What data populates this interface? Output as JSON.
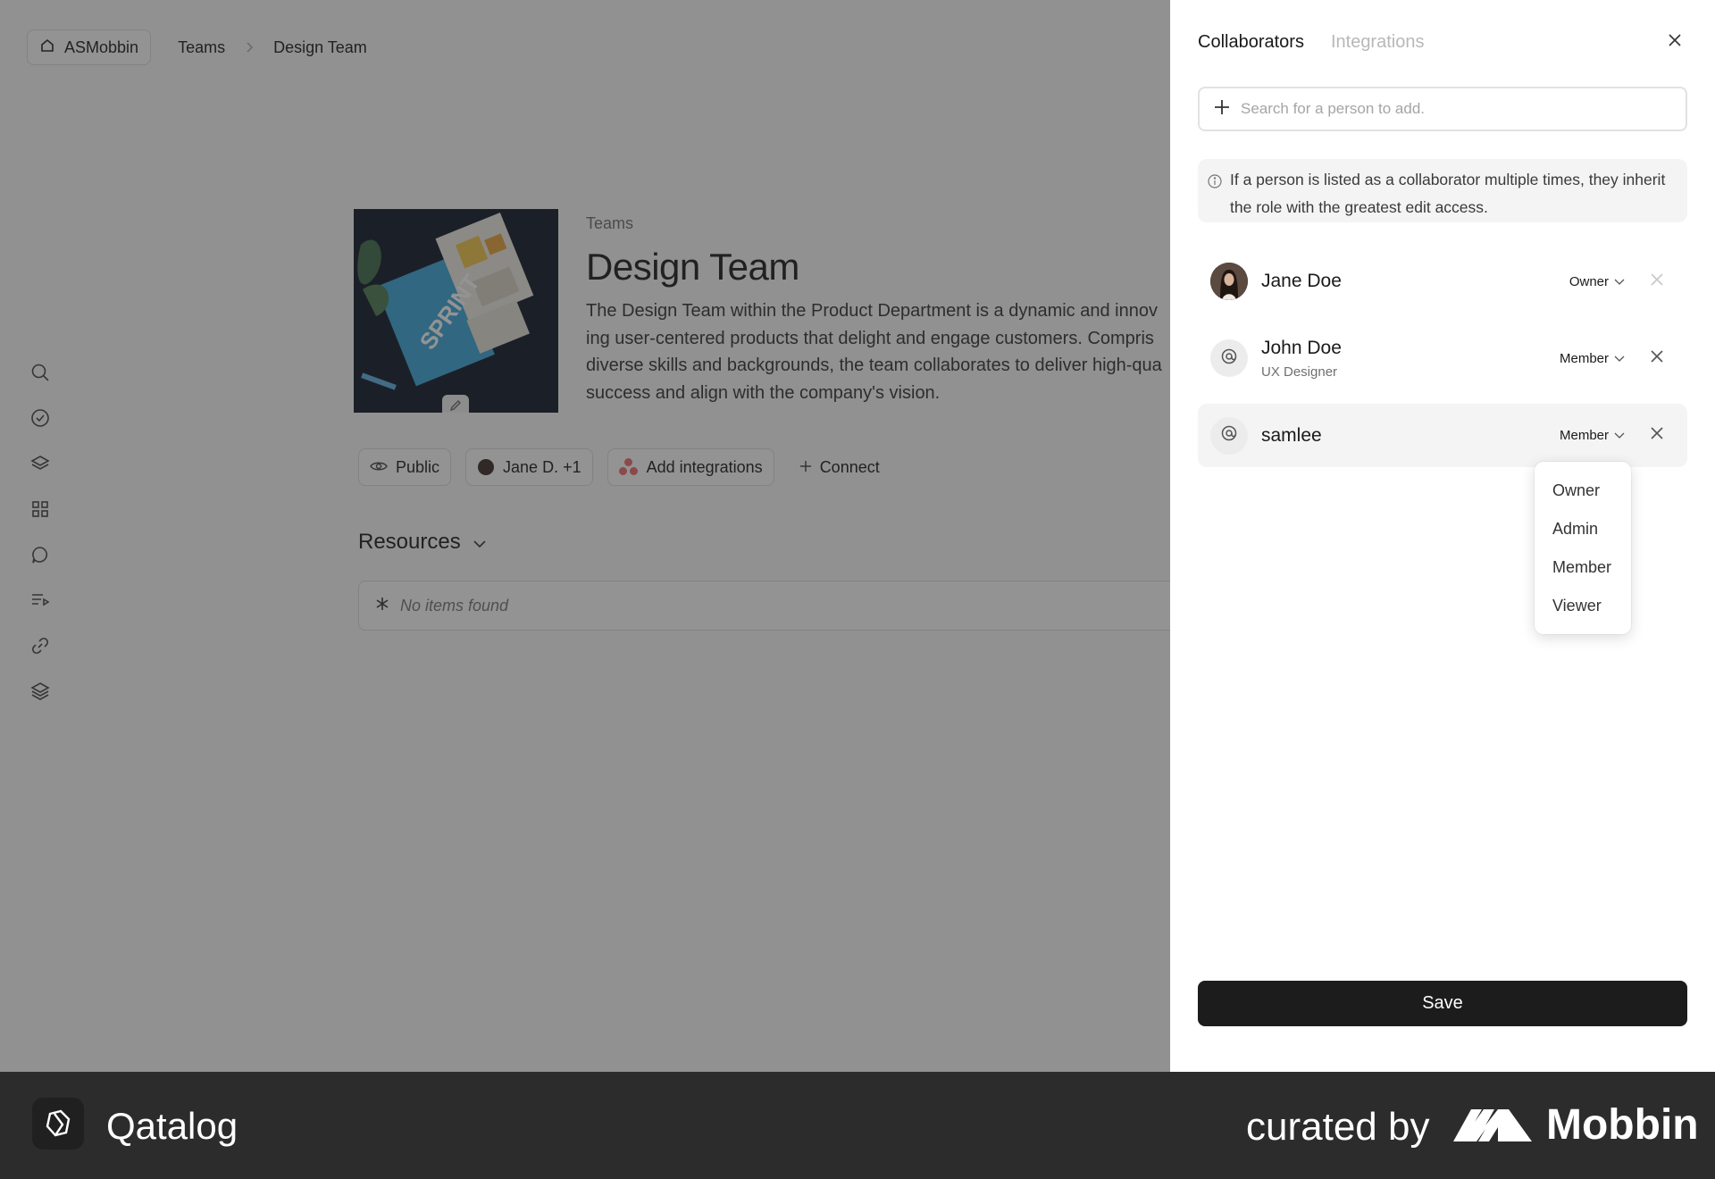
{
  "breadcrumb": {
    "home": "ASMobbin",
    "items": [
      "Teams",
      "Design Team"
    ]
  },
  "rail_icons": [
    "search-icon",
    "check-circle-icon",
    "layers-icon",
    "grid-icon",
    "chat-icon",
    "playlist-icon",
    "link-icon",
    "stack-icon"
  ],
  "team": {
    "kicker": "Teams",
    "title": "Design Team",
    "description_lines": [
      "The Design Team within the Product Department is a dynamic and innov",
      "ing user-centered products that delight and engage customers. Compris",
      "diverse skills and backgrounds, the team collaborates to deliver high-qua",
      "success and align with the company's vision."
    ],
    "cover_text": "SPRINT"
  },
  "chips": {
    "visibility": "Public",
    "members": "Jane D. +1",
    "integrations": "Add integrations",
    "connect": "Connect"
  },
  "resources": {
    "heading": "Resources",
    "empty": "No items found"
  },
  "panel": {
    "tabs": [
      "Collaborators",
      "Integrations"
    ],
    "search_placeholder": "Search for a person to add.",
    "info_lines": [
      "If a person is listed as a collaborator multiple times, they inherit",
      "the role with the greatest edit access."
    ],
    "people": [
      {
        "name": "Jane Doe",
        "subtitle": "",
        "role": "Owner",
        "avatar": "photo"
      },
      {
        "name": "John Doe",
        "subtitle": "UX Designer",
        "role": "Member",
        "avatar": "generic"
      },
      {
        "name": "samlee",
        "subtitle": "",
        "role": "Member",
        "avatar": "generic"
      }
    ],
    "role_menu": [
      "Owner",
      "Admin",
      "Member",
      "Viewer"
    ],
    "save_label": "Save"
  },
  "footer": {
    "brand": "Qatalog",
    "curated_by": "curated by",
    "curator": "Mobbin"
  },
  "colors": {
    "overlay": "#282828",
    "button": "#1c1c1c",
    "footer": "#2c2c2c",
    "asana": "#f06a6a"
  }
}
